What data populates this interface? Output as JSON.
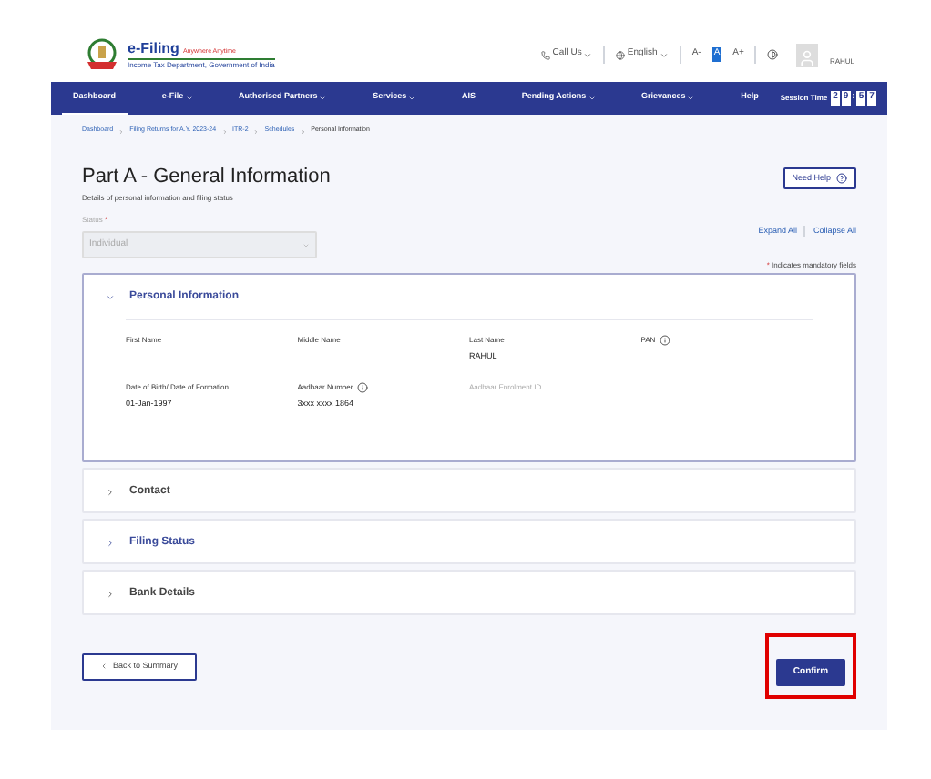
{
  "header": {
    "logo_title": "e-Filing",
    "logo_tagline": "Anywhere Anytime",
    "logo_subtitle": "Income Tax Department, Government of India",
    "call_us": "Call Us",
    "language": "English",
    "font_smaller": "A-",
    "font_default": "A",
    "font_larger": "A+",
    "user_name": "RAHUL"
  },
  "nav": {
    "items": [
      {
        "label": "Dashboard",
        "selected": true,
        "dropdown": false
      },
      {
        "label": "e-File",
        "selected": false,
        "dropdown": true
      },
      {
        "label": "Authorised Partners",
        "selected": false,
        "dropdown": true
      },
      {
        "label": "Services",
        "selected": false,
        "dropdown": true
      },
      {
        "label": "AIS",
        "selected": false,
        "dropdown": false
      },
      {
        "label": "Pending Actions",
        "selected": false,
        "dropdown": true
      },
      {
        "label": "Grievances",
        "selected": false,
        "dropdown": true
      },
      {
        "label": "Help",
        "selected": false,
        "dropdown": false
      }
    ],
    "session_label": "Session Time",
    "session_digits": [
      "2",
      "9",
      ":",
      "5",
      "7"
    ]
  },
  "breadcrumb": [
    "Dashboard",
    "Filing Returns for A.Y. 2023-24",
    "ITR-2",
    "Schedules",
    "Personal Information"
  ],
  "page": {
    "title": "Part A - General Information",
    "subtitle": "Details of personal information and filing status",
    "help_button": "Need Help",
    "status_label": "Status",
    "required_mark": "*",
    "status_value": "Individual",
    "expand_all": "Expand All",
    "collapse_all": "Collapse All",
    "mandatory_mark": "*",
    "mandatory_note": "Indicates mandatory fields"
  },
  "sections": [
    {
      "title": "Personal Information",
      "expanded": true,
      "fields": [
        {
          "label": "First Name",
          "info": false,
          "disabled": false
        },
        {
          "label": "Middle Name",
          "info": false,
          "disabled": false
        },
        {
          "label": "Last Name",
          "value": "RAHUL",
          "info": false,
          "disabled": false
        },
        {
          "label": "PAN",
          "info": true,
          "disabled": false
        },
        {
          "label": "Date of Birth/ Date of Formation",
          "value": "01-Jan-1997",
          "info": false,
          "disabled": false
        },
        {
          "label": "Aadhaar Number",
          "value": "3xxx xxxx 1864",
          "info": true,
          "disabled": false
        },
        {
          "label": "Aadhaar Enrolment ID",
          "info": false,
          "disabled": true
        }
      ]
    },
    {
      "title": "Contact",
      "expanded": false
    },
    {
      "title": "Filing Status",
      "expanded": false
    },
    {
      "title": "Bank Details",
      "expanded": false
    }
  ],
  "footer": {
    "back_button": "Back to Summary",
    "confirm_button": "Confirm",
    "confirm_highlighted": true
  }
}
